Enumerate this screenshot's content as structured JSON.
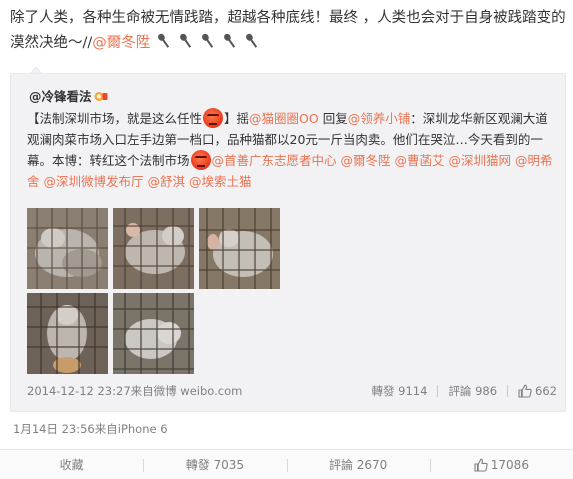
{
  "post": {
    "text": "除了人类，各种生命被无情践踏，超越各种底线！最终 ，人类也会对于自身被践踏变的漠然决绝～//",
    "mention": "@爾冬陞",
    "mic_icon": "microphone-icon",
    "mic_count": 5
  },
  "repost": {
    "author": "@冷锋看法",
    "text_a": "【法制深圳市场，就是这么任性",
    "text_b": "】摇",
    "mention_1": "@猫圈圈OO",
    "text_c": " 回复",
    "mention_2": "@领养小铺",
    "text_d": "：深圳龙华新区观澜大道观澜肉菜市场入口左手边第一档口，品种猫都以20元一斤当肉卖。他们在哭泣…今天看到的一幕。本博：转红这个法制市场",
    "mentions": [
      "@首善广东志愿者中心",
      "@爾冬陞",
      "@曹菡艾",
      "@深圳猫网",
      "@明希舍",
      "@深圳微博发布厅",
      "@舒淇",
      "@埃索土猫"
    ],
    "meta": "2014-12-12 23:27来自微博 weibo.com",
    "repost_label": "轉發 9114",
    "comment_label": "評論 986",
    "like_count": "662"
  },
  "meta": "1月14日 23:56来自iPhone 6",
  "actions": {
    "favorite": "收藏",
    "repost": "轉發 7035",
    "comment": "評論 2670",
    "like": "17086"
  },
  "colors": {
    "link": "#eb7350",
    "meta": "#808080",
    "repost_bg": "#f2f2f5"
  }
}
